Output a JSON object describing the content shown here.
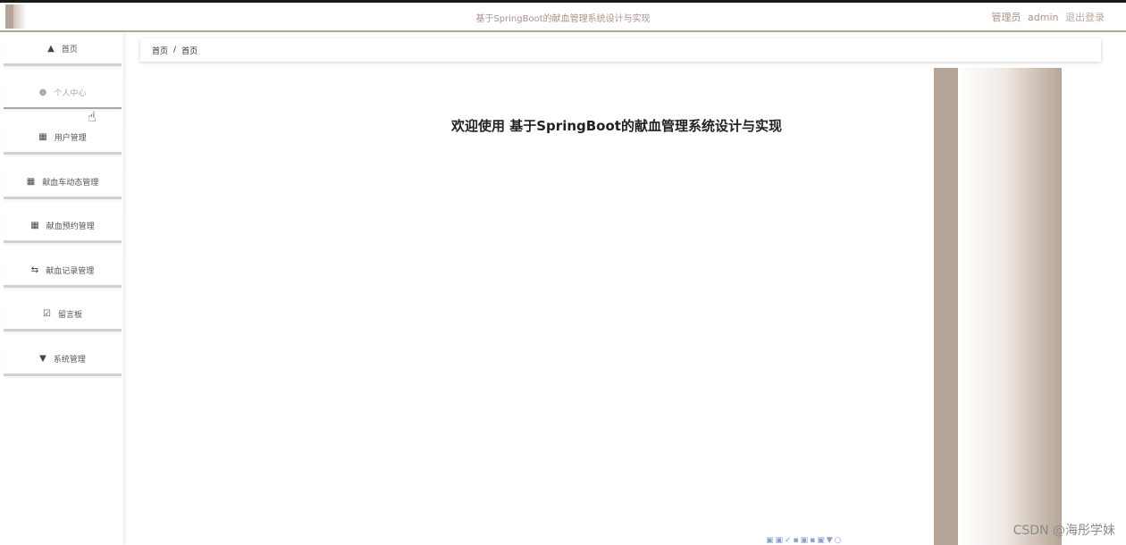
{
  "header": {
    "title": "基于SpringBoot的献血管理系统设计与实现",
    "role_label": "管理员",
    "username": "admin",
    "logout_label": "退出登录"
  },
  "sidebar": {
    "items": [
      {
        "label": "首页",
        "icon": "home-icon"
      },
      {
        "label": "个人中心",
        "icon": "user-icon"
      },
      {
        "label": "用户管理",
        "icon": "grid-icon"
      },
      {
        "label": "献血车动态管理",
        "icon": "grid-icon"
      },
      {
        "label": "献血预约管理",
        "icon": "grid-icon"
      },
      {
        "label": "献血记录管理",
        "icon": "exchange-icon"
      },
      {
        "label": "留言板",
        "icon": "checkbox-icon"
      },
      {
        "label": "系统管理",
        "icon": "funnel-icon"
      }
    ]
  },
  "breadcrumb": {
    "root": "首页",
    "separator": "/",
    "current": "首页"
  },
  "main": {
    "welcome_text": "欢迎使用 基于SpringBoot的献血管理系统设计与实现"
  },
  "watermark": "CSDN @海彤学妹",
  "colors": {
    "accent": "#b5a599",
    "header_text": "#a8938a"
  }
}
